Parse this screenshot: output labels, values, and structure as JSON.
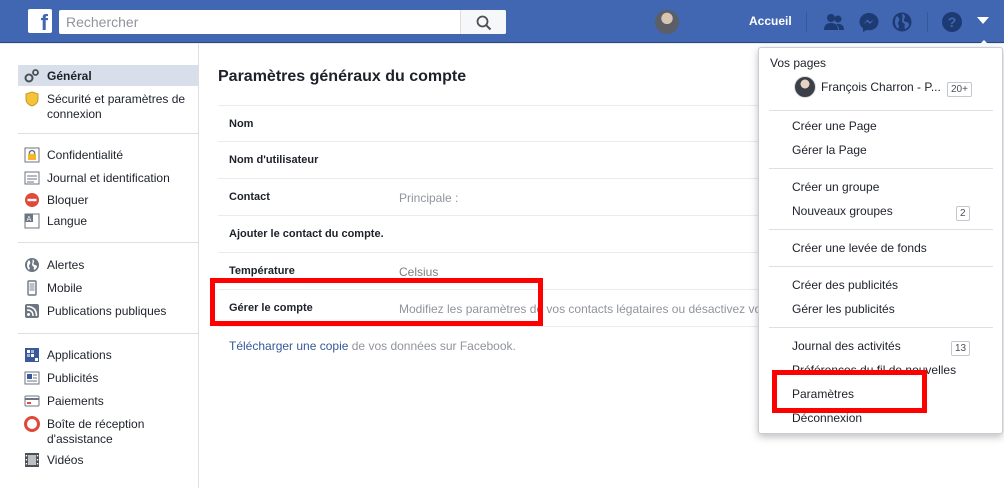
{
  "search": {
    "placeholder": "Rechercher"
  },
  "topnav": {
    "home_label": "Accueil"
  },
  "sidebar": {
    "groups": [
      [
        {
          "label": "Général",
          "icon": "gears-icon"
        },
        {
          "label": "Sécurité et paramètres de connexion",
          "icon": "shield-icon"
        }
      ],
      [
        {
          "label": "Confidentialité",
          "icon": "lock-icon"
        },
        {
          "label": "Journal et identification",
          "icon": "log-icon"
        },
        {
          "label": "Bloquer",
          "icon": "block-icon"
        },
        {
          "label": "Langue",
          "icon": "language-icon"
        }
      ],
      [
        {
          "label": "Alertes",
          "icon": "globe-icon"
        },
        {
          "label": "Mobile",
          "icon": "mobile-icon"
        },
        {
          "label": "Publications publiques",
          "icon": "rss-icon"
        }
      ],
      [
        {
          "label": "Applications",
          "icon": "apps-icon"
        },
        {
          "label": "Publicités",
          "icon": "ads-icon"
        },
        {
          "label": "Paiements",
          "icon": "card-icon"
        },
        {
          "label": "Boîte de réception d'assistance",
          "icon": "lifebuoy-icon"
        },
        {
          "label": "Vidéos",
          "icon": "film-icon"
        }
      ]
    ]
  },
  "main": {
    "title": "Paramètres généraux du compte",
    "rows": [
      {
        "key": "Nom",
        "value": ""
      },
      {
        "key": "Nom d'utilisateur",
        "value": ""
      },
      {
        "key": "Contact",
        "value": "Principale :"
      },
      {
        "key": "Ajouter le contact du compte.",
        "value": ""
      },
      {
        "key": "Température",
        "value": "Celsius"
      },
      {
        "key": "Gérer le compte",
        "value": "Modifiez les paramètres de vos contacts légataires ou désactivez vo"
      }
    ],
    "download": {
      "link1": "Télécharger une copie",
      "rest": " de vos données sur Facebook."
    }
  },
  "dropdown": {
    "heading": "Vos pages",
    "page_name": "François Charron - P...",
    "page_count": "20+",
    "items": {
      "create_page": "Créer une Page",
      "manage_page": "Gérer la Page",
      "create_group": "Créer un groupe",
      "new_groups": "Nouveaux groupes",
      "new_groups_count": "2",
      "fundraiser": "Créer une levée de fonds",
      "create_ads": "Créer des publicités",
      "manage_ads": "Gérer les publicités",
      "activity_log": "Journal des activités",
      "activity_count": "13",
      "news_feed_prefs": "Préférences du fil de nouvelles",
      "settings": "Paramètres",
      "logout": "Déconnexion"
    }
  }
}
